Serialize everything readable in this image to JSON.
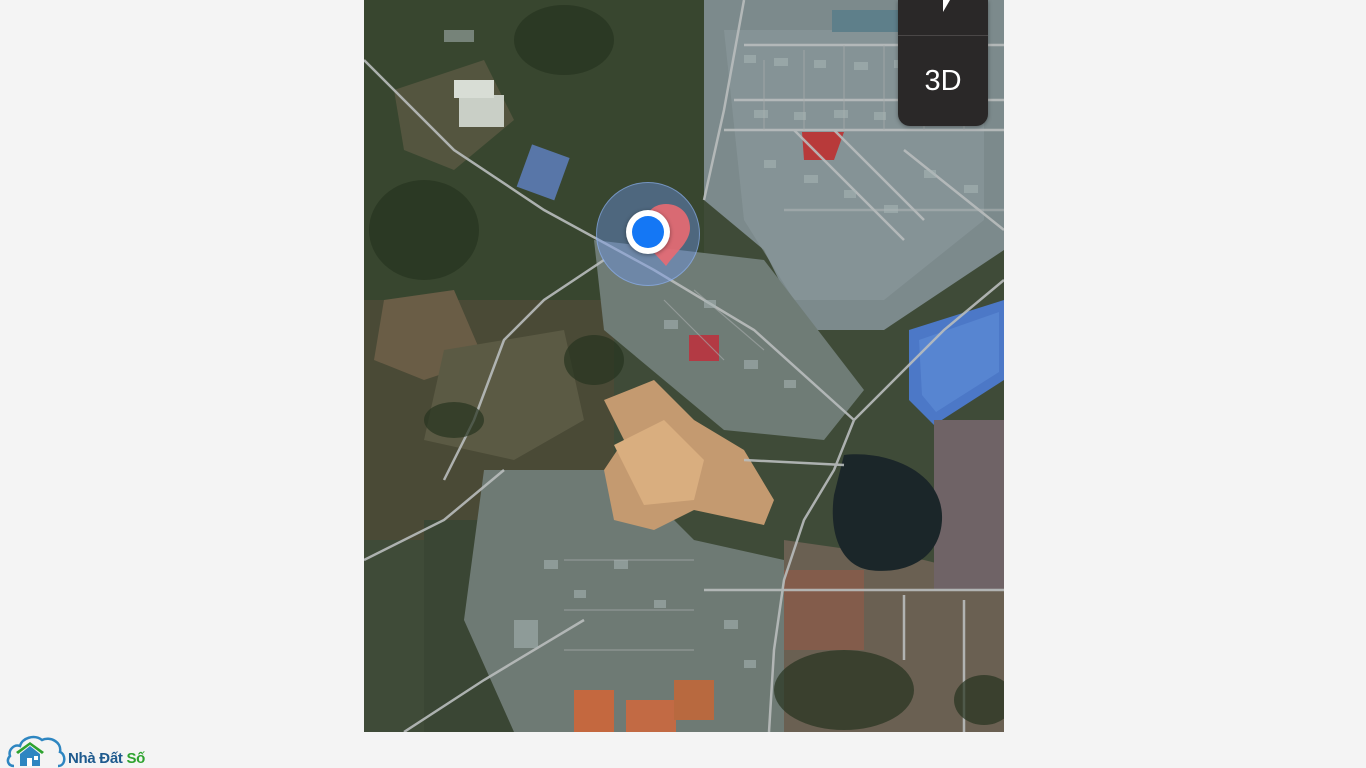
{
  "map": {
    "mode_button_label": "3D",
    "compass_icon": "compass-arrow-icon",
    "location_dot_icon": "current-location-dot",
    "place_marker_icon": "map-pin-icon",
    "colors": {
      "accuracy": "#6e96eb",
      "dot": "#1477f5",
      "pin": "#e96a72",
      "control_bg": "#2a2828"
    }
  },
  "brand": {
    "name_part1": "Nhà Đất ",
    "name_part2": "Số",
    "logo_icon": "cloud-house-icon",
    "colors": {
      "primary": "#1e5a8e",
      "accent": "#2ea32f"
    }
  }
}
